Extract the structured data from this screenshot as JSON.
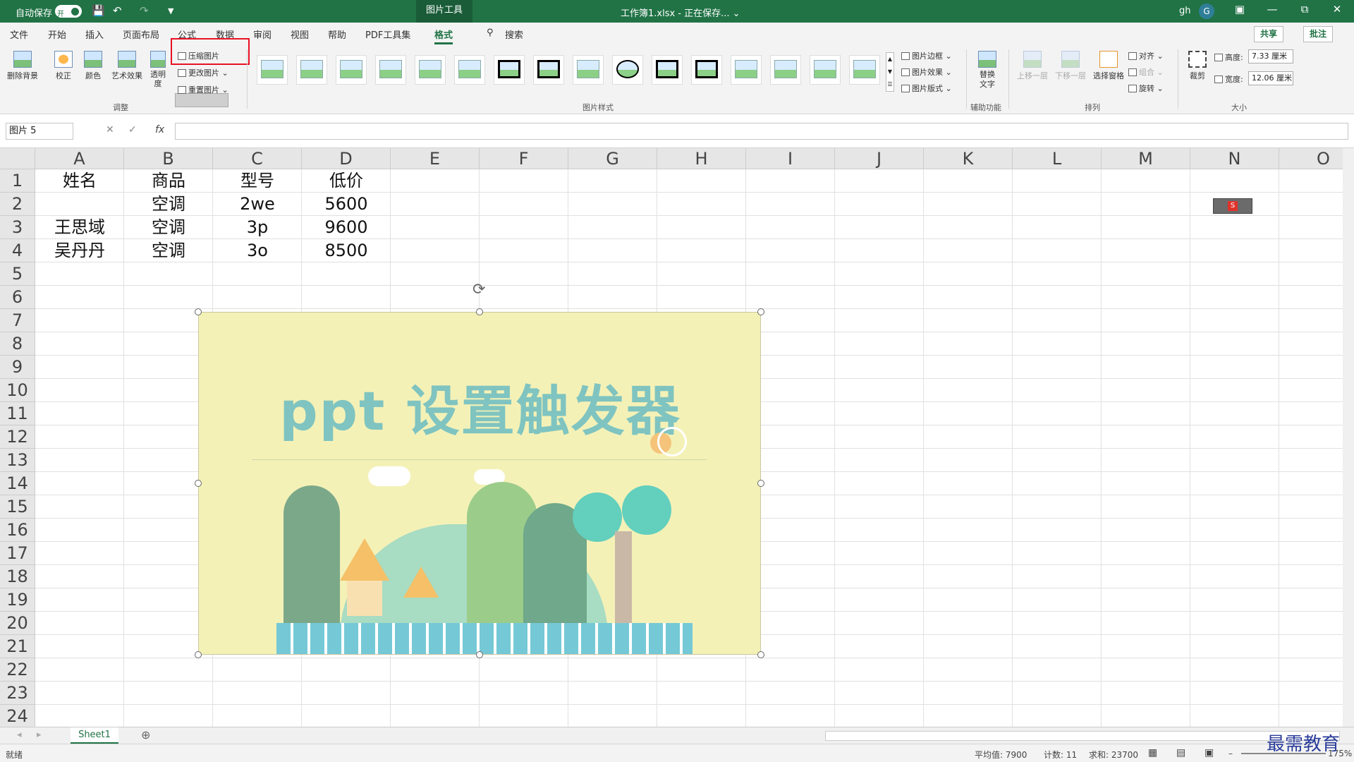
{
  "titlebar": {
    "autosave_label": "自动保存",
    "autosave_state": "开",
    "context_tab": "图片工具",
    "doc_title": "工作簿1.xlsx - 正在保存... ⌄",
    "user": "gh",
    "avatar": "G"
  },
  "tabs": [
    "文件",
    "开始",
    "插入",
    "页面布局",
    "公式",
    "数据",
    "审阅",
    "视图",
    "帮助",
    "PDF工具集",
    "格式"
  ],
  "active_tab": "格式",
  "search_label": "搜索",
  "share_label": "共享",
  "comment_label": "批注",
  "ribbon": {
    "remove_bg": "删除背景",
    "correct": "校正",
    "color": "颜色",
    "art_effect": "艺术效果",
    "transparency": "透明度",
    "compress": "压缩图片",
    "change_pic": "更改图片",
    "reset_pic": "重置图片",
    "adjust_group": "调整",
    "styles_group": "图片样式",
    "pic_border": "图片边框",
    "pic_effect": "图片效果",
    "pic_layout": "图片版式",
    "alt_text": "替换文字",
    "access_group": "辅助功能",
    "bring_forward": "上移一层",
    "send_backward": "下移一层",
    "selection_pane": "选择窗格",
    "align": "对齐",
    "group": "组合",
    "rotate": "旋转",
    "arrange_group": "排列",
    "crop": "裁剪",
    "height_label": "高度:",
    "height_value": "7.33 厘米",
    "width_label": "宽度:",
    "width_value": "12.06 厘米",
    "size_group": "大小"
  },
  "namebox": "图片 5",
  "columns": [
    "A",
    "B",
    "C",
    "D",
    "E",
    "F",
    "G",
    "H",
    "I",
    "J",
    "K",
    "L",
    "M",
    "N",
    "O"
  ],
  "rows": [
    "1",
    "2",
    "3",
    "4",
    "5",
    "6",
    "7",
    "8",
    "9",
    "10",
    "11",
    "12",
    "13",
    "14",
    "15",
    "16",
    "17",
    "18",
    "19",
    "20",
    "21",
    "22",
    "23",
    "24"
  ],
  "cells": {
    "A1": "姓名",
    "B1": "商品",
    "C1": "型号",
    "D1": "低价",
    "B2": "空调",
    "C2": "2we",
    "D2": "5600",
    "A3": "王思域",
    "B3": "空调",
    "C3": "3p",
    "D3": "9600",
    "A4": "吴丹丹",
    "B4": "空调",
    "C4": "3o",
    "D4": "8500"
  },
  "picture_text": "ppt 设置触发器",
  "sheet_name": "Sheet1",
  "status": {
    "ready": "就绪",
    "average": "平均值: 7900",
    "count": "计数: 11",
    "sum": "求和: 23700",
    "zoom": "175%"
  },
  "watermark": "最需教育"
}
